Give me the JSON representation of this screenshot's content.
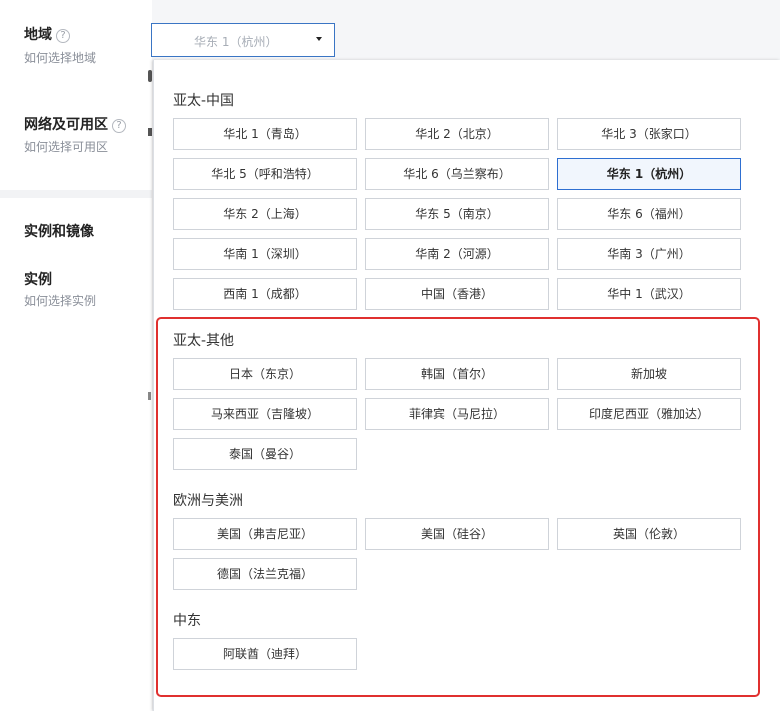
{
  "form": {
    "region_label": "地域",
    "region_help": "如何选择地域",
    "network_label": "网络及可用区",
    "network_help": "如何选择可用区",
    "instance_section_label": "实例和镜像",
    "instance_label": "实例",
    "instance_help": "如何选择实例",
    "help_icon_glyph": "?"
  },
  "select": {
    "value": "华东 1（杭州）"
  },
  "groups": [
    {
      "title": "亚太-中国",
      "items": [
        {
          "label": "华北 1（青岛）"
        },
        {
          "label": "华北 2（北京）"
        },
        {
          "label": "华北 3（张家口）"
        },
        {
          "label": "华北 5（呼和浩特）"
        },
        {
          "label": "华北 6（乌兰察布）"
        },
        {
          "label": "华东 1（杭州）",
          "selected": true
        },
        {
          "label": "华东 2（上海）"
        },
        {
          "label": "华东 5（南京）"
        },
        {
          "label": "华东 6（福州）"
        },
        {
          "label": "华南 1（深圳）"
        },
        {
          "label": "华南 2（河源）"
        },
        {
          "label": "华南 3（广州）"
        },
        {
          "label": "西南 1（成都）"
        },
        {
          "label": "中国（香港）"
        },
        {
          "label": "华中 1（武汉）"
        }
      ]
    },
    {
      "title": "亚太-其他",
      "items": [
        {
          "label": "日本（东京）"
        },
        {
          "label": "韩国（首尔）"
        },
        {
          "label": "新加坡"
        },
        {
          "label": "马来西亚（吉隆坡）"
        },
        {
          "label": "菲律宾（马尼拉）"
        },
        {
          "label": "印度尼西亚（雅加达）"
        },
        {
          "label": "泰国（曼谷）"
        }
      ]
    },
    {
      "title": "欧洲与美洲",
      "items": [
        {
          "label": "美国（弗吉尼亚）"
        },
        {
          "label": "美国（硅谷）"
        },
        {
          "label": "英国（伦敦）"
        },
        {
          "label": "德国（法兰克福）"
        }
      ]
    },
    {
      "title": "中东",
      "items": [
        {
          "label": "阿联酋（迪拜）"
        }
      ]
    }
  ],
  "colors": {
    "accent": "#2e6fd1",
    "highlight_border": "#e0302f"
  }
}
